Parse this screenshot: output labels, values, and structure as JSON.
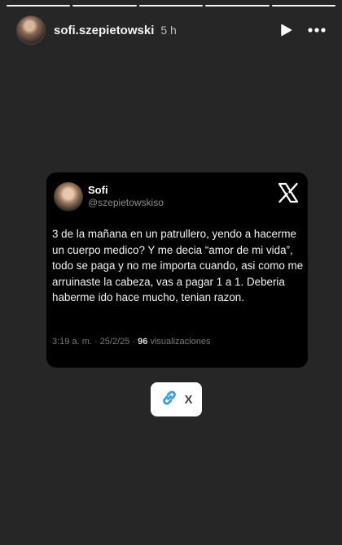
{
  "story": {
    "progress_total": 5,
    "progress_done": 5,
    "username": "sofi.szepietowski",
    "time": "5 h",
    "play_icon": "play-icon",
    "more_icon": "more-icon"
  },
  "tweet": {
    "name": "Sofi",
    "handle": "@szepietowskiso",
    "brand_icon": "x-logo-icon",
    "text": "3 de la mañana en un patrullero, yendo a hacerme un cuerpo medico? Y me decia “amor de mi vida”, todo se paga y no me importa cuando, asi como me arruinaste la cabeza, vas a pagar 1 a 1. Deberia haberme ido hace mucho, tenian razon.",
    "meta_prefix": "3:19 a. m. · 25/2/25 · ",
    "views": "96",
    "views_label": " visualizaciones"
  },
  "sticker": {
    "icon": "link-icon",
    "label": "X"
  },
  "colors": {
    "background": "#262626",
    "card": "#000000",
    "link_blue": "#3aa0e6"
  }
}
